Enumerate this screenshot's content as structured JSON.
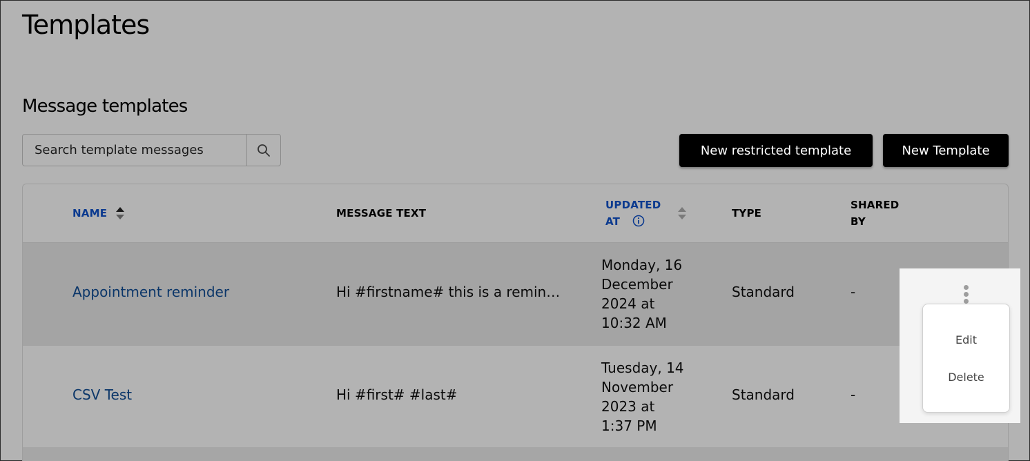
{
  "page": {
    "title": "Templates"
  },
  "section": {
    "title": "Message templates"
  },
  "search": {
    "placeholder": "Search template messages",
    "icon": "search-icon"
  },
  "buttons": {
    "new_restricted": "New restricted template",
    "new_template": "New Template"
  },
  "table": {
    "columns": {
      "name": "NAME",
      "message_text": "MESSAGE TEXT",
      "updated_at_line1": "UPDATED",
      "updated_at_line2": "AT",
      "type": "TYPE",
      "shared_by_line1": "SHARED",
      "shared_by_line2": "BY"
    },
    "rows": [
      {
        "name": "Appointment reminder",
        "message_text": "Hi #firstname# this is a remin…",
        "updated_at": "Monday, 16 December 2024 at 10:32 AM",
        "type": "Standard",
        "shared_by": "-"
      },
      {
        "name": "CSV Test",
        "message_text": "Hi #first# #last#",
        "updated_at": "Tuesday, 14 November 2023 at 1:37 PM",
        "type": "Standard",
        "shared_by": "-"
      }
    ]
  },
  "row_menu": {
    "edit": "Edit",
    "delete": "Delete"
  },
  "colors": {
    "background": "#b3b3b3",
    "link": "#0b3669",
    "header_link": "#0b3a8f",
    "button_bg": "#000000",
    "menu_bg": "#ffffff"
  }
}
